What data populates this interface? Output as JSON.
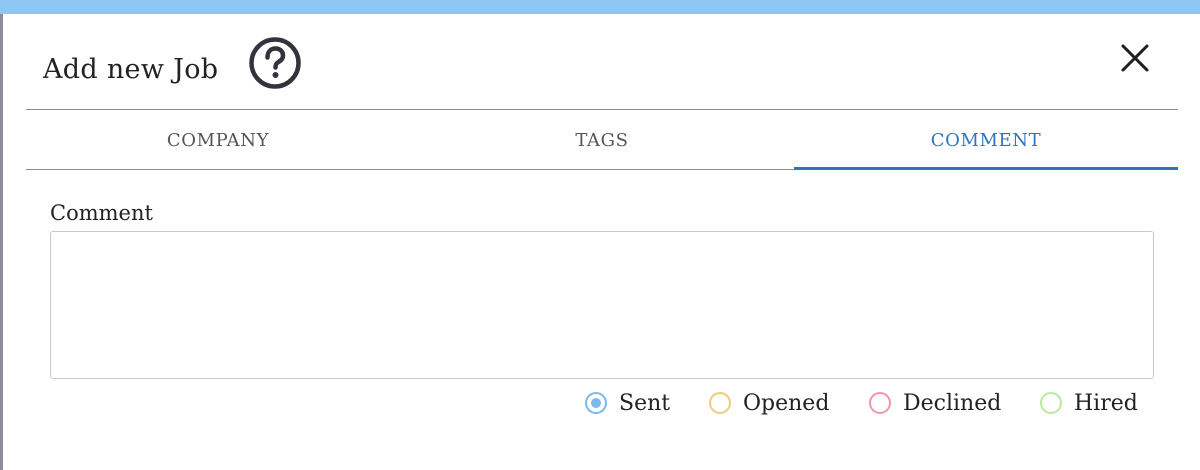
{
  "dialog": {
    "title": "Add new Job",
    "help_icon": "help-circle-icon",
    "close_icon": "close-icon"
  },
  "tabs": [
    {
      "label": "COMPANY",
      "active": false
    },
    {
      "label": "TAGS",
      "active": false
    },
    {
      "label": "COMMENT",
      "active": true
    }
  ],
  "comment": {
    "label": "Comment",
    "value": ""
  },
  "status": {
    "selected": "Sent",
    "options": [
      {
        "label": "Sent",
        "color": "#7ab9ee"
      },
      {
        "label": "Opened",
        "color": "#f4c97f"
      },
      {
        "label": "Declined",
        "color": "#ec9aa9"
      },
      {
        "label": "Hired",
        "color": "#b7ec9a"
      }
    ]
  },
  "colors": {
    "accent": "#2f74c0",
    "top_strip": "#8ec6f2"
  }
}
